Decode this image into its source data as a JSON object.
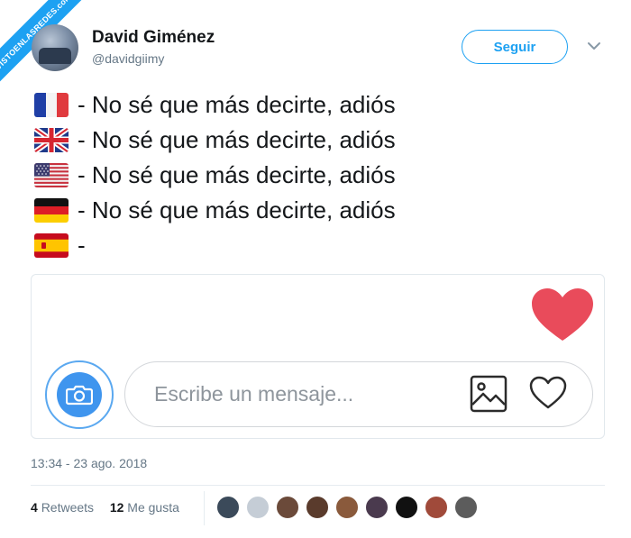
{
  "watermark": {
    "text": "VISTOENLASREDES.com"
  },
  "user": {
    "display_name": "David Giménez",
    "handle": "@davidgiimy",
    "avatar_icon": "avatar-photo"
  },
  "follow_button": {
    "label": "Seguir"
  },
  "menu_icon": "chevron-down-icon",
  "tweet": {
    "lines": [
      {
        "flag": "flag-france",
        "text": "- No sé que más decirte, adiós"
      },
      {
        "flag": "flag-uk",
        "text": "- No sé que más decirte, adiós"
      },
      {
        "flag": "flag-usa",
        "text": "- No sé que más decirte, adiós"
      },
      {
        "flag": "flag-germany",
        "text": "- No sé que más decirte, adiós"
      },
      {
        "flag": "flag-spain",
        "text": "-"
      }
    ]
  },
  "media_card": {
    "heart_icon": "heart-filled-icon",
    "camera_icon": "camera-icon",
    "message_placeholder": "Escribe un mensaje...",
    "image_icon": "image-icon",
    "like_icon": "heart-outline-icon"
  },
  "timestamp": "13:34 - 23 ago. 2018",
  "stats": {
    "retweets_count": "4",
    "retweets_label": "Retweets",
    "likes_count": "12",
    "likes_label": "Me gusta"
  },
  "likers": [
    {
      "color": "#3b4a5a"
    },
    {
      "color": "#c5cdd6"
    },
    {
      "color": "#6b4a3a"
    },
    {
      "color": "#5a3b2c"
    },
    {
      "color": "#8a5a3c"
    },
    {
      "color": "#4a3a4e"
    },
    {
      "color": "#111111"
    },
    {
      "color": "#a04a3a"
    },
    {
      "color": "#5c5c5c"
    }
  ],
  "colors": {
    "accent": "#1da1f2",
    "heart": "#e94b5b",
    "camera": "#3f95ee",
    "secondary_text": "#657786"
  }
}
